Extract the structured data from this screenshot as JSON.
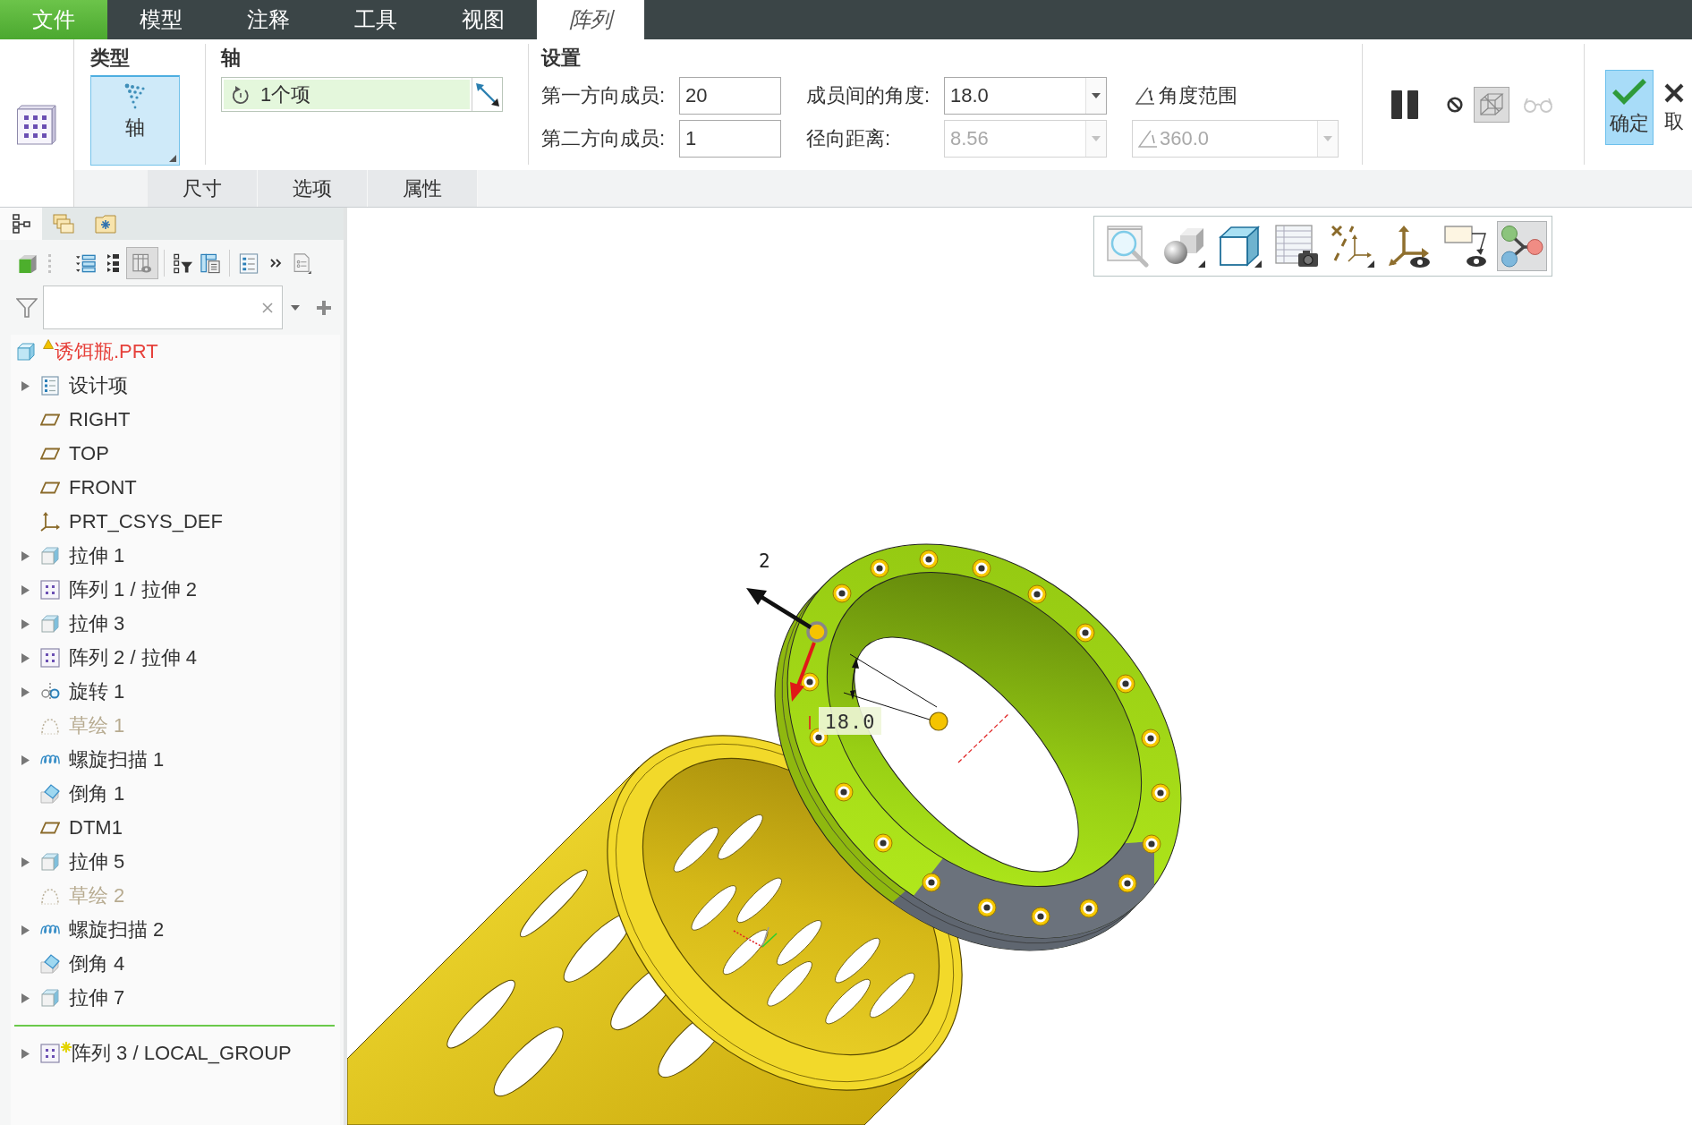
{
  "menu_tabs": [
    {
      "label": "文件",
      "kind": "file",
      "selected": false
    },
    {
      "label": "模型",
      "kind": "tab",
      "selected": false
    },
    {
      "label": "注释",
      "kind": "tab",
      "selected": false
    },
    {
      "label": "工具",
      "kind": "tab",
      "selected": false
    },
    {
      "label": "视图",
      "kind": "tab",
      "selected": false
    },
    {
      "label": "阵列",
      "kind": "tab",
      "selected": true
    }
  ],
  "ribbon": {
    "type_group": {
      "title": "类型",
      "button": {
        "label": "轴",
        "selected": true
      }
    },
    "axis_group": {
      "title": "轴",
      "collector": {
        "value": "1个项"
      }
    },
    "settings_group": {
      "title": "设置",
      "columns": [
        {
          "rows": [
            {
              "label": "第一方向成员:",
              "value": "20",
              "kind": "input",
              "disabled": false
            },
            {
              "label": "第二方向成员:",
              "value": "1",
              "kind": "input",
              "disabled": false
            }
          ]
        },
        {
          "rows": [
            {
              "label": "成员间的角度:",
              "value": "18.0",
              "kind": "dropdown",
              "disabled": false
            },
            {
              "label": "径向距离:",
              "value": "8.56",
              "kind": "dropdown",
              "disabled": true
            }
          ]
        }
      ],
      "angle_range": {
        "label": "角度范围",
        "value": "360.0",
        "disabled": true
      }
    },
    "tools": [
      {
        "kind": "pause",
        "selected": false,
        "disabled": false
      },
      {
        "kind": "stop",
        "selected": false,
        "disabled": false
      },
      {
        "kind": "preview",
        "selected": true,
        "disabled": false
      },
      {
        "kind": "verify",
        "selected": false,
        "disabled": true
      }
    ],
    "actions": [
      {
        "kind": "ok",
        "label": "确定",
        "highlighted": true
      },
      {
        "kind": "cancel",
        "label": "取",
        "highlighted": false
      }
    ],
    "subtabs": [
      {
        "label": "尺寸"
      },
      {
        "label": "选项"
      },
      {
        "label": "属性"
      }
    ]
  },
  "navigator": {
    "tabs": [
      {
        "kind": "model-tree",
        "selected": true
      },
      {
        "kind": "layers",
        "selected": false
      },
      {
        "kind": "favorites",
        "selected": false
      }
    ],
    "toolbar": [
      [
        {
          "kind": "model-display",
          "selected": false
        }
      ],
      [
        {
          "kind": "expand",
          "selected": false
        },
        {
          "kind": "collapse",
          "selected": false
        },
        {
          "kind": "columns",
          "selected": true
        }
      ],
      [
        {
          "kind": "tree-filter",
          "selected": false
        },
        {
          "kind": "tree-columns",
          "selected": false
        }
      ],
      [
        {
          "kind": "settings-list",
          "selected": false
        },
        {
          "kind": "more",
          "selected": false
        },
        {
          "kind": "document",
          "selected": false
        }
      ]
    ],
    "tree": {
      "root": {
        "label": "诱饵瓶.PRT",
        "warning": true
      },
      "items": [
        {
          "label": "设计项",
          "kind": "design-items",
          "expandable": true,
          "dimmed": false,
          "new": false
        },
        {
          "label": "RIGHT",
          "kind": "plane",
          "expandable": false,
          "dimmed": false,
          "new": false
        },
        {
          "label": "TOP",
          "kind": "plane",
          "expandable": false,
          "dimmed": false,
          "new": false
        },
        {
          "label": "FRONT",
          "kind": "plane",
          "expandable": false,
          "dimmed": false,
          "new": false
        },
        {
          "label": "PRT_CSYS_DEF",
          "kind": "csys",
          "expandable": false,
          "dimmed": false,
          "new": false
        },
        {
          "label": "拉伸 1",
          "kind": "extrude",
          "expandable": true,
          "dimmed": false,
          "new": false
        },
        {
          "label": "阵列 1 / 拉伸 2",
          "kind": "pattern",
          "expandable": true,
          "dimmed": false,
          "new": false
        },
        {
          "label": "拉伸 3",
          "kind": "extrude",
          "expandable": true,
          "dimmed": false,
          "new": false
        },
        {
          "label": "阵列 2 / 拉伸 4",
          "kind": "pattern",
          "expandable": true,
          "dimmed": false,
          "new": false
        },
        {
          "label": "旋转 1",
          "kind": "revolve",
          "expandable": true,
          "dimmed": false,
          "new": false
        },
        {
          "label": "草绘 1",
          "kind": "sketch",
          "expandable": false,
          "dimmed": true,
          "new": false
        },
        {
          "label": "螺旋扫描 1",
          "kind": "helical-sweep",
          "expandable": true,
          "dimmed": false,
          "new": false
        },
        {
          "label": "倒角 1",
          "kind": "chamfer",
          "expandable": false,
          "dimmed": false,
          "new": false
        },
        {
          "label": "DTM1",
          "kind": "plane",
          "expandable": false,
          "dimmed": false,
          "new": false
        },
        {
          "label": "拉伸 5",
          "kind": "extrude",
          "expandable": true,
          "dimmed": false,
          "new": false
        },
        {
          "label": "草绘 2",
          "kind": "sketch",
          "expandable": false,
          "dimmed": true,
          "new": false
        },
        {
          "label": "螺旋扫描 2",
          "kind": "helical-sweep",
          "expandable": true,
          "dimmed": false,
          "new": false
        },
        {
          "label": "倒角 4",
          "kind": "chamfer",
          "expandable": false,
          "dimmed": false,
          "new": false
        },
        {
          "label": "拉伸 7",
          "kind": "extrude",
          "expandable": true,
          "dimmed": false,
          "new": false
        }
      ],
      "after_insert": [
        {
          "label": "阵列 3 / LOCAL_GROUP",
          "kind": "pattern",
          "expandable": true,
          "dimmed": false,
          "new": true
        }
      ]
    }
  },
  "graphics": {
    "view_toolbar": [
      {
        "kind": "zoom",
        "selected": false
      },
      {
        "kind": "display-style",
        "selected": false
      },
      {
        "kind": "saved-views",
        "selected": false
      },
      {
        "kind": "snapshot",
        "selected": false
      },
      {
        "kind": "datum-display",
        "selected": false
      },
      {
        "kind": "csys-display",
        "selected": false
      },
      {
        "kind": "annotation-display",
        "selected": false
      },
      {
        "kind": "node-view",
        "selected": true
      }
    ],
    "model": {
      "direction_label": "2",
      "angle_dimension": "18.0"
    }
  }
}
